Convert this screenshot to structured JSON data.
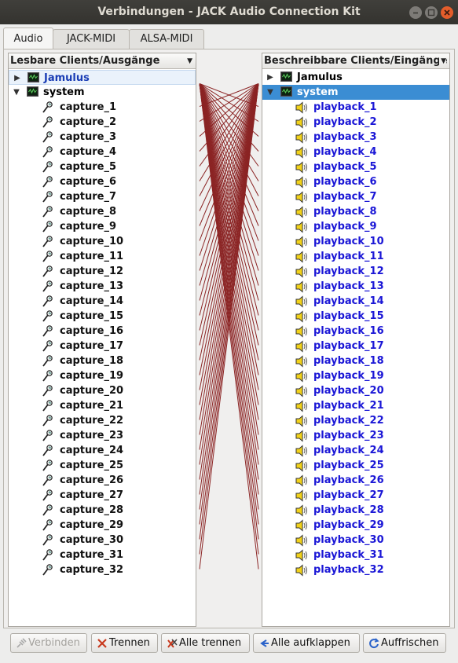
{
  "window": {
    "title": "Verbindungen - JACK Audio Connection Kit"
  },
  "tabs": [
    {
      "label": "Audio",
      "active": true
    },
    {
      "label": "JACK-MIDI",
      "active": false
    },
    {
      "label": "ALSA-MIDI",
      "active": false
    }
  ],
  "left_panel": {
    "header": "Lesbare Clients/Ausgänge",
    "clients": [
      {
        "name": "Jamulus",
        "expanded": false
      },
      {
        "name": "system",
        "expanded": true
      }
    ],
    "ports": [
      "capture_1",
      "capture_2",
      "capture_3",
      "capture_4",
      "capture_5",
      "capture_6",
      "capture_7",
      "capture_8",
      "capture_9",
      "capture_10",
      "capture_11",
      "capture_12",
      "capture_13",
      "capture_14",
      "capture_15",
      "capture_16",
      "capture_17",
      "capture_18",
      "capture_19",
      "capture_20",
      "capture_21",
      "capture_22",
      "capture_23",
      "capture_24",
      "capture_25",
      "capture_26",
      "capture_27",
      "capture_28",
      "capture_29",
      "capture_30",
      "capture_31",
      "capture_32"
    ]
  },
  "right_panel": {
    "header": "Beschreibbare Clients/Eingänge",
    "clients": [
      {
        "name": "Jamulus",
        "expanded": false
      },
      {
        "name": "system",
        "expanded": true,
        "selected": true
      }
    ],
    "ports": [
      "playback_1",
      "playback_2",
      "playback_3",
      "playback_4",
      "playback_5",
      "playback_6",
      "playback_7",
      "playback_8",
      "playback_9",
      "playback_10",
      "playback_11",
      "playback_12",
      "playback_13",
      "playback_14",
      "playback_15",
      "playback_16",
      "playback_17",
      "playback_18",
      "playback_19",
      "playback_20",
      "playback_21",
      "playback_22",
      "playback_23",
      "playback_24",
      "playback_25",
      "playback_26",
      "playback_27",
      "playback_28",
      "playback_29",
      "playback_30",
      "playback_31",
      "playback_32"
    ]
  },
  "connection_color": "#8b2424",
  "buttons": {
    "connect": "Verbinden",
    "disconnect": "Trennen",
    "disconnect_all": "Alle trennen",
    "expand_all": "Alle aufklappen",
    "refresh": "Auffrischen"
  }
}
